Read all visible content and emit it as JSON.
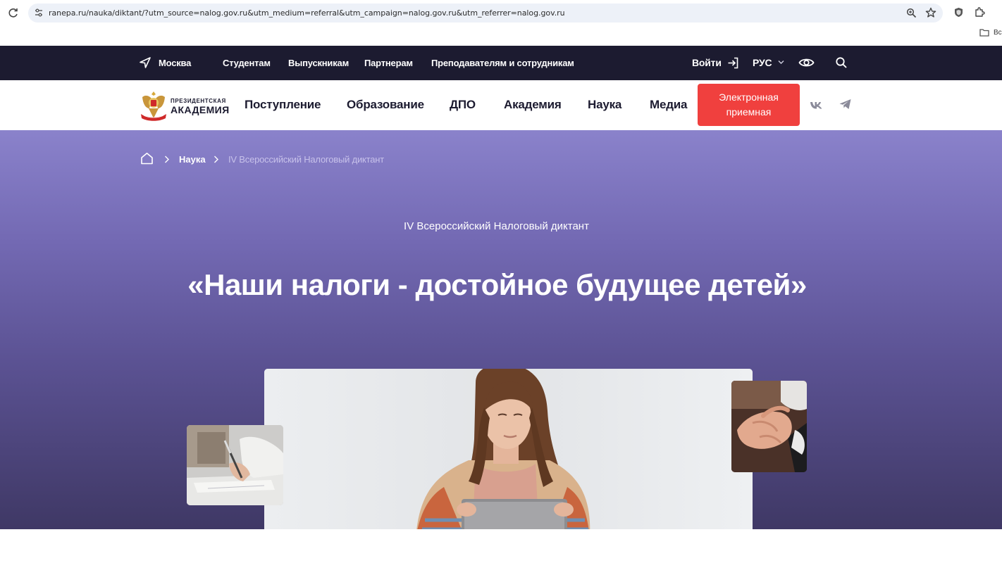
{
  "browser": {
    "url": "ranepa.ru/nauka/diktant/?utm_source=nalog.gov.ru&utm_medium=referral&utm_campaign=nalog.gov.ru&utm_referrer=nalog.gov.ru",
    "bookmarks_label": "Вс"
  },
  "topbar": {
    "city": "Москва",
    "links": [
      "Студентам",
      "Выпускникам",
      "Партнерам",
      "Преподавателям и сотрудникам"
    ],
    "login": "Войти",
    "lang": "РУС"
  },
  "logo": {
    "line1": "ПРЕЗИДЕНТСКАЯ",
    "line2": "АКАДЕМИЯ"
  },
  "nav": {
    "items": [
      "Поступление",
      "Образование",
      "ДПО",
      "Академия",
      "Наука",
      "Медиа"
    ],
    "cta_line1": "Электронная",
    "cta_line2": "приемная"
  },
  "breadcrumb": {
    "section": "Наука",
    "current": "IV Всероссийский Налоговый диктант"
  },
  "hero": {
    "subtitle": "IV Всероссийский Налоговый диктант",
    "title": "«Наши налоги - достойное будущее детей»"
  },
  "colors": {
    "topbar_bg": "#1c1b30",
    "accent_red": "#f0403e",
    "hero_top": "#8a82cb",
    "hero_bottom": "#3f3865"
  }
}
